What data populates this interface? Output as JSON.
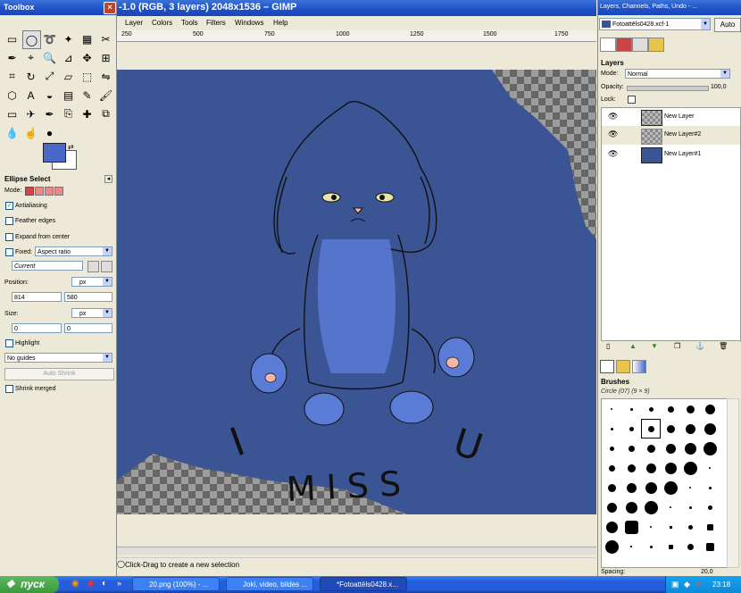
{
  "toolbox": {
    "title": "Toolbox",
    "tool_options_title": "Ellipse Select",
    "mode_label": "Mode:",
    "antialiasing_label": "Antialiasing",
    "feather_label": "Feather edges",
    "expand_label": "Expand from center",
    "fixed_label": "Fixed:",
    "fixed_value": "Aspect ratio",
    "current_value": "Current",
    "position_label": "Position:",
    "position_unit": "px",
    "position_x": "814",
    "position_y": "580",
    "size_label": "Size:",
    "size_unit": "px",
    "size_w": "0",
    "size_h": "0",
    "highlight_label": "Highlight",
    "guides_value": "No guides",
    "auto_shrink_label": "Auto Shrink",
    "shrink_merged_label": "Shrink merged"
  },
  "image_window": {
    "title": "-1.0 (RGB, 3 layers) 2048x1536 – GIMP",
    "menu": [
      "Layer",
      "Colors",
      "Tools",
      "Filters",
      "Windows",
      "Help"
    ],
    "ruler_ticks": [
      "250",
      "500",
      "750",
      "1000",
      "1250",
      "1500",
      "1750"
    ],
    "status_text": "Click-Drag to create a new selection",
    "drawing_text": [
      "I",
      "MISS",
      "U"
    ]
  },
  "dock": {
    "title": "Layers, Channels, Paths, Undo - ...",
    "image_select": "Fotoattēls0428.xcf-1",
    "auto_label": "Auto",
    "layers_title": "Layers",
    "mode_label": "Mode:",
    "mode_value": "Normal",
    "opacity_label": "Opacity:",
    "opacity_value": "100,0",
    "lock_label": "Lock:",
    "layers": [
      {
        "name": "New Layer"
      },
      {
        "name": "New Layer#2"
      },
      {
        "name": "New Layer#1"
      }
    ],
    "brushes_title": "Brushes",
    "brush_name": "Circle (07) (9 × 9)",
    "spacing_label": "Spacing:",
    "spacing_value": "20,0"
  },
  "taskbar": {
    "start_label": "пуск",
    "buttons": [
      "20.png (100%) - ...",
      "Joki, video, bildes ...",
      "*Fotoattēls0428.x..."
    ],
    "clock": "23:18"
  },
  "colors": {
    "canvas_blue": "#3a5494",
    "fg_color": "#4a68c7",
    "title_blue": "#1d50c8",
    "taskbar_blue": "#245edb",
    "start_green": "#3a9a3a"
  }
}
